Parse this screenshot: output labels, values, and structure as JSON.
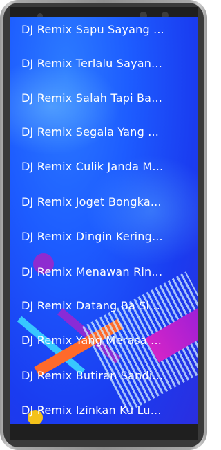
{
  "playlist": {
    "items": [
      {
        "label": "DJ Remix Sapu Sayang ..."
      },
      {
        "label": "DJ Remix Terlalu Sayan..."
      },
      {
        "label": "DJ Remix Salah Tapi Ba..."
      },
      {
        "label": "DJ Remix Segala Yang ..."
      },
      {
        "label": "DJ Remix Culik Janda M..."
      },
      {
        "label": "DJ Remix Joget Bongka..."
      },
      {
        "label": "DJ Remix Dingin Kering..."
      },
      {
        "label": "DJ Remix Menawan Rin..."
      },
      {
        "label": "DJ Remix Datang Ba Si..."
      },
      {
        "label": "DJ Remix Yang Merasa ..."
      },
      {
        "label": "DJ Remix Butiran Sandi..."
      },
      {
        "label": "DJ Remix Izinkan Ku Lu..."
      }
    ]
  },
  "colors": {
    "background_primary": "#1d5cff",
    "text": "#ffffff",
    "device_frame": "#3a3a3a"
  }
}
